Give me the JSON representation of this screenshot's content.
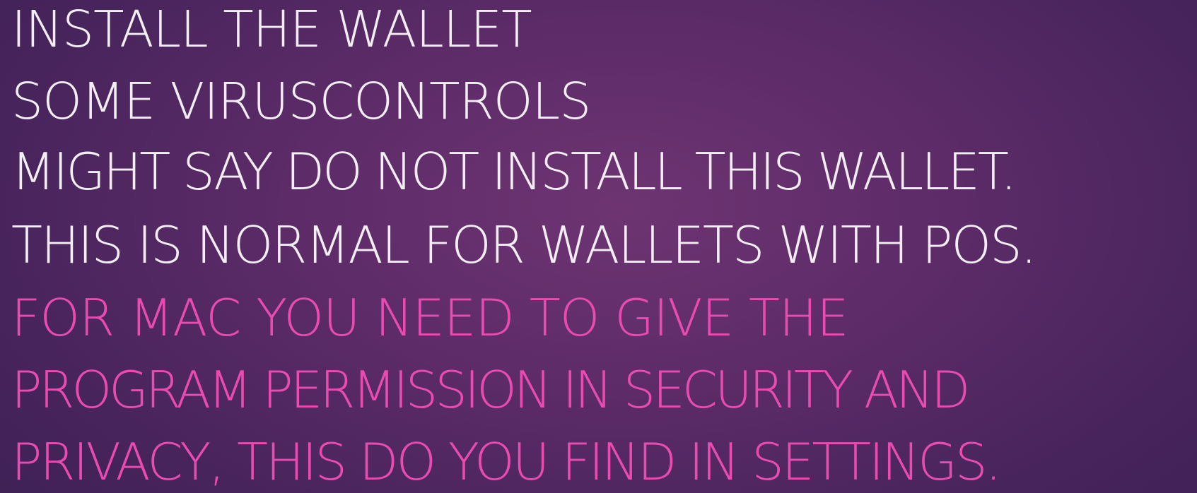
{
  "slide": {
    "lines": [
      {
        "text": "INSTALL THE WALLET",
        "color": "#f2eef4"
      },
      {
        "text": "SOME VIRUSCONTROLS",
        "color": "#f2eef4"
      },
      {
        "text": "MIGHT SAY DO NOT INSTALL THIS WALLET.",
        "color": "#f2eef4"
      },
      {
        "text": "THIS IS NORMAL FOR WALLETS WITH POS.",
        "color": "#f2eef4"
      },
      {
        "text": "FOR MAC YOU NEED TO GIVE THE",
        "color": "#e94bb0"
      },
      {
        "text": "PROGRAM PERMISSION IN SECURITY AND",
        "color": "#e94bb0"
      },
      {
        "text": "PRIVACY, THIS DO YOU FIND IN SETTINGS.",
        "color": "#e94bb0"
      }
    ]
  },
  "theme": {
    "background": "#5c2b68",
    "text_primary": "#f2eef4",
    "text_accent": "#e94bb0"
  }
}
